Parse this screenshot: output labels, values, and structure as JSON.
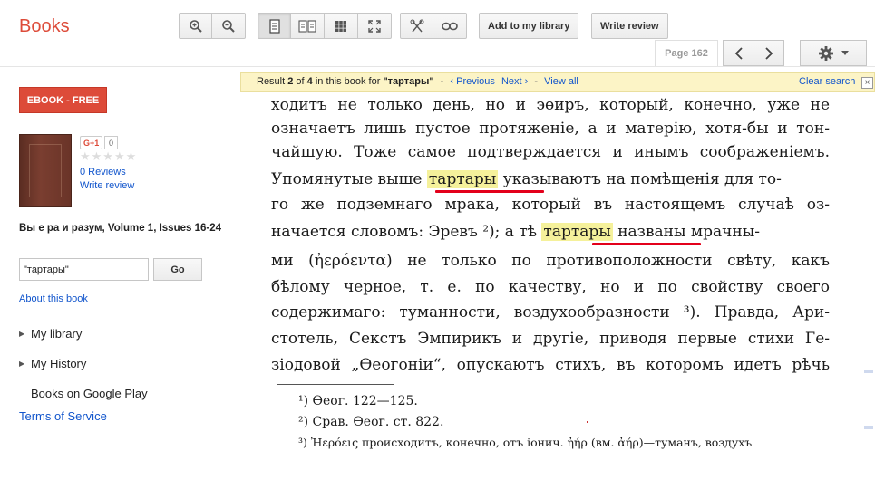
{
  "header": {
    "logo": "Books",
    "add_library": "Add to my library",
    "write_review": "Write review",
    "page_indicator": "Page 162",
    "accent": "#dd4b39"
  },
  "toolbar_icons": [
    "zoom-in-icon",
    "zoom-out-icon",
    "single-page-icon",
    "two-page-icon",
    "thumbnails-icon",
    "fullscreen-icon",
    "clip-icon",
    "link-icon",
    "chevron-left-icon",
    "chevron-right-icon",
    "gear-icon"
  ],
  "sidebar": {
    "ebook_button": "EBOOK - FREE",
    "gplus_label": "G+1",
    "gplus_count": "0",
    "stars": "★★★★★",
    "reviews": "0 Reviews",
    "write_review": "Write review",
    "book_title": "Вы е ра и разум, Volume 1, Issues 16-24",
    "search_value": "\"тартары\"",
    "go": "Go",
    "about": "About this book",
    "my_library": "My library",
    "my_history": "My History",
    "books_on_play": "Books on Google Play",
    "terms": "Terms of Service"
  },
  "search_bar": {
    "result_prefix": "Result ",
    "result_index": "2",
    "result_mid": " of ",
    "result_total": "4",
    "result_suffix": " in this book for ",
    "query": "\"тартары\"",
    "dash": "-",
    "previous": "‹ Previous",
    "next": "Next ›",
    "view_all": "View all",
    "clear": "Clear search",
    "close": "×"
  },
  "page_text": {
    "l1": "ходитъ не только день, но и эөиръ, который, конечно, уже не",
    "l2": "означаетъ лишь пустое протяженіе, а и матерію, хотя-бы и тон-",
    "l3": "чайшую. Тоже самое подтверждается и инымъ соображеніемъ.",
    "l4a": "Упомянутые выше",
    "l4b": "тартары",
    "l4c": "указываютъ на помѣщенія для то-",
    "l5": "го же подземнаго мрака, который въ настоящемъ случаѣ оз-",
    "l6a": "начается словомъ: Эревъ ²); а тѣ",
    "l6b": "тартары",
    "l6c": "названы мрачны-",
    "l7": "ми (ἠερόεντα) не только по противоположности свѣту, какъ",
    "l8": "бѣлому черное, т. е. по качеству, но и по свойству своего",
    "l9": "содержимаго: туманности, воздухообразности ³). Правда, Ари-",
    "l10": "стотель, Секстъ Эмпирикъ и другіе, приводя первые стихи Ге-",
    "l11": "зіодовой „Өеогоніи“, опускаютъ стихъ, въ которомъ идетъ рѣчь",
    "fn1": "¹) Өеог. 122—125.",
    "fn2": "²) Срав. Өеог. ст. 822.",
    "fn3": "³) Ἠερόεις происходитъ, конечно, отъ іонич. ἠήρ (вм. ἀήρ)—туманъ, воздухъ"
  }
}
